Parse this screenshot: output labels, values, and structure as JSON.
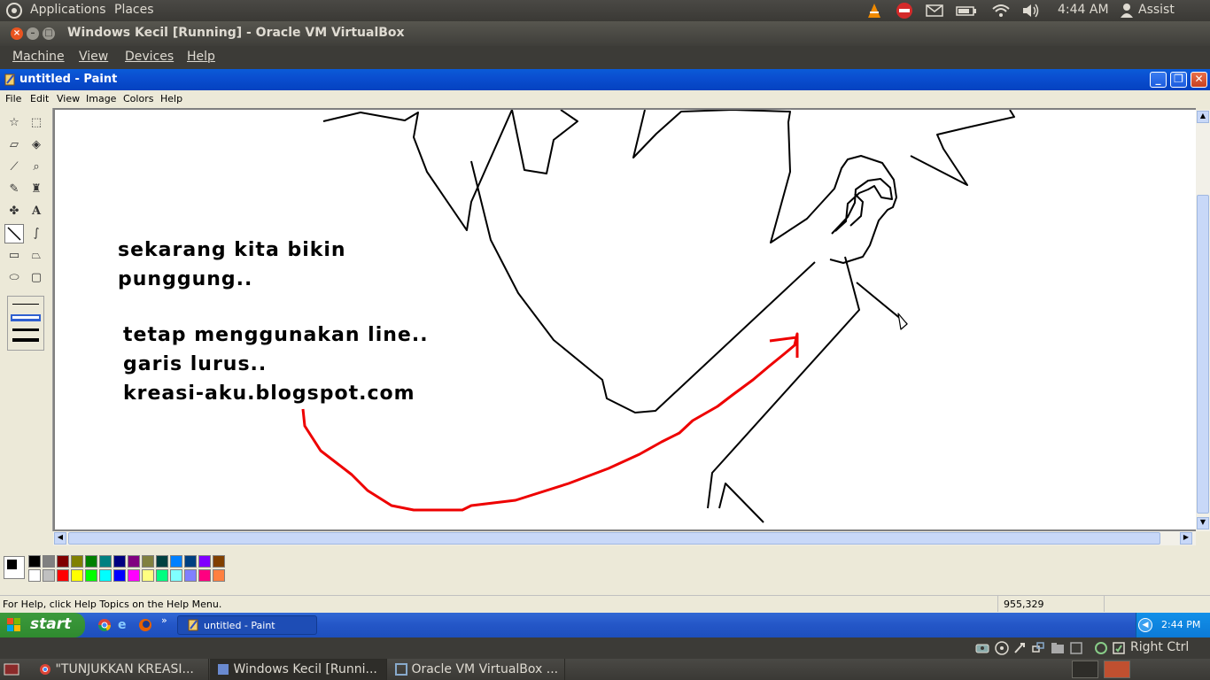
{
  "top_panel": {
    "applications": "Applications",
    "places": "Places",
    "clock": "4:44 AM",
    "user": "Assist"
  },
  "vbox_window": {
    "title": "Windows Kecil [Running] - Oracle VM VirtualBox"
  },
  "vbox_menu": [
    "Machine",
    "View",
    "Devices",
    "Help"
  ],
  "paint": {
    "title": "untitled - Paint",
    "menu": [
      "File",
      "Edit",
      "View",
      "Image",
      "Colors",
      "Help"
    ],
    "canvas_text": {
      "line1": "sekarang kita bikin",
      "line2": "punggung..",
      "line3": "tetap menggunakan line..",
      "line4": "garis lurus..",
      "line5": "kreasi-aku.blogspot.com"
    },
    "status_help": "For Help, click Help Topics on the Help Menu.",
    "coords": "955,329",
    "palette_top": [
      "#000000",
      "#808080",
      "#800000",
      "#808000",
      "#008000",
      "#008080",
      "#000080",
      "#800080",
      "#808040",
      "#004040",
      "#0080ff",
      "#004080",
      "#8000ff",
      "#804000"
    ],
    "palette_bottom": [
      "#ffffff",
      "#c0c0c0",
      "#ff0000",
      "#ffff00",
      "#00ff00",
      "#00ffff",
      "#0000ff",
      "#ff00ff",
      "#ffff80",
      "#00ff80",
      "#80ffff",
      "#8080ff",
      "#ff0080",
      "#ff8040"
    ]
  },
  "xp_taskbar": {
    "start": "start",
    "task": "untitled - Paint",
    "clock": "2:44 PM"
  },
  "vbox_status": {
    "host_key": "Right Ctrl"
  },
  "bottom_panel": {
    "tasks": [
      "\"TUNJUKKAN KREASI...",
      "Windows Kecil [Runni...",
      "Oracle VM VirtualBox ..."
    ]
  }
}
